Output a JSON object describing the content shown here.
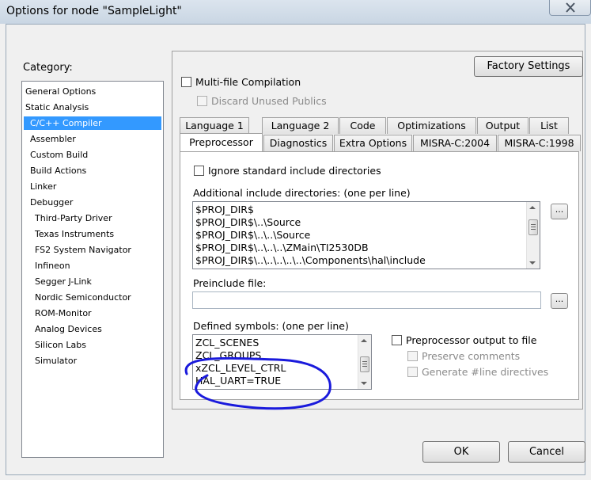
{
  "window": {
    "title": "Options for node \"SampleLight\""
  },
  "category": {
    "label": "Category:",
    "items": [
      {
        "label": "General Options",
        "indent": 0,
        "selected": false
      },
      {
        "label": "Static Analysis",
        "indent": 0,
        "selected": false
      },
      {
        "label": "C/C++ Compiler",
        "indent": 1,
        "selected": true
      },
      {
        "label": "Assembler",
        "indent": 1,
        "selected": false
      },
      {
        "label": "Custom Build",
        "indent": 1,
        "selected": false
      },
      {
        "label": "Build Actions",
        "indent": 1,
        "selected": false
      },
      {
        "label": "Linker",
        "indent": 1,
        "selected": false
      },
      {
        "label": "Debugger",
        "indent": 1,
        "selected": false
      },
      {
        "label": "Third-Party Driver",
        "indent": 2,
        "selected": false
      },
      {
        "label": "Texas Instruments",
        "indent": 2,
        "selected": false
      },
      {
        "label": "FS2 System Navigator",
        "indent": 2,
        "selected": false
      },
      {
        "label": "Infineon",
        "indent": 2,
        "selected": false
      },
      {
        "label": "Segger J-Link",
        "indent": 2,
        "selected": false
      },
      {
        "label": "Nordic Semiconductor",
        "indent": 2,
        "selected": false
      },
      {
        "label": "ROM-Monitor",
        "indent": 2,
        "selected": false
      },
      {
        "label": "Analog Devices",
        "indent": 2,
        "selected": false
      },
      {
        "label": "Silicon Labs",
        "indent": 2,
        "selected": false
      },
      {
        "label": "Simulator",
        "indent": 2,
        "selected": false
      }
    ]
  },
  "factory_settings_label": "Factory Settings",
  "multi_file": {
    "label": "Multi-file Compilation",
    "checked": false
  },
  "discard_unused": {
    "label": "Discard Unused Publics",
    "checked": false
  },
  "tabs_row1": [
    "Language 1",
    "Language 2",
    "Code",
    "Optimizations",
    "Output",
    "List"
  ],
  "tabs_row2": [
    "Preprocessor",
    "Diagnostics",
    "Extra Options",
    "MISRA-C:2004",
    "MISRA-C:1998"
  ],
  "active_tab": "Preprocessor",
  "preprocessor": {
    "ignore_std": {
      "label": "Ignore standard include directories",
      "checked": false
    },
    "include_dirs_label": "Additional include directories: (one per line)",
    "include_dirs": [
      "$PROJ_DIR$",
      "$PROJ_DIR$\\..\\Source",
      "$PROJ_DIR$\\..\\..\\Source",
      "$PROJ_DIR$\\..\\..\\..\\ZMain\\TI2530DB",
      "$PROJ_DIR$\\..\\..\\..\\..\\..\\Components\\hal\\include"
    ],
    "browse_label": "...",
    "preinclude_label": "Preinclude file:",
    "preinclude_value": "",
    "defined_symbols_label": "Defined symbols: (one per line)",
    "defined_symbols": [
      "ZCL_SCENES",
      "ZCL_GROUPS",
      "xZCL_LEVEL_CTRL",
      "HAL_UART=TRUE"
    ],
    "output_to_file": {
      "label": "Preprocessor output to file",
      "checked": false
    },
    "preserve_comments": {
      "label": "Preserve comments",
      "checked": false
    },
    "generate_line": {
      "label": "Generate #line directives",
      "checked": false
    }
  },
  "buttons": {
    "ok": "OK",
    "cancel": "Cancel"
  },
  "annotation_color": "#1a1adc"
}
